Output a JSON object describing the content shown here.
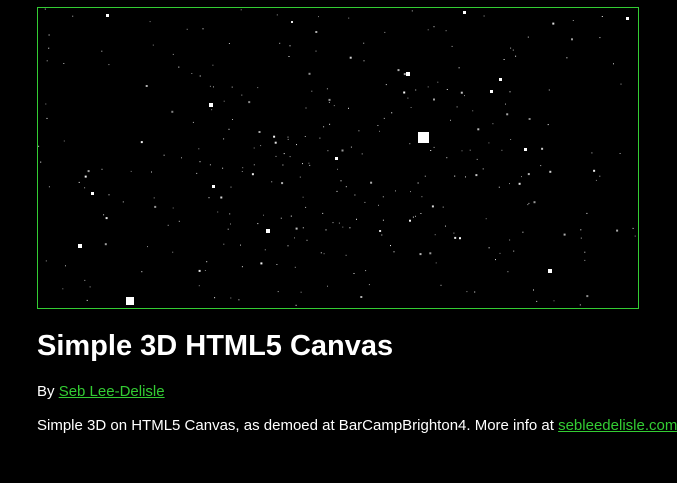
{
  "canvas": {
    "border_color": "#33cc33",
    "background": "#000000",
    "star_color": "#ffffff"
  },
  "page": {
    "title": "Simple 3D HTML5 Canvas",
    "byline_prefix": "By ",
    "author_link": "Seb Lee-Delisle",
    "description_text": "Simple 3D on HTML5 Canvas, as demoed at BarCampBrighton4. More info at ",
    "site_link": "sebleedelisle.com",
    "description_suffix": ".",
    "link_color": "#33cc33",
    "text_color": "#ffffff"
  }
}
